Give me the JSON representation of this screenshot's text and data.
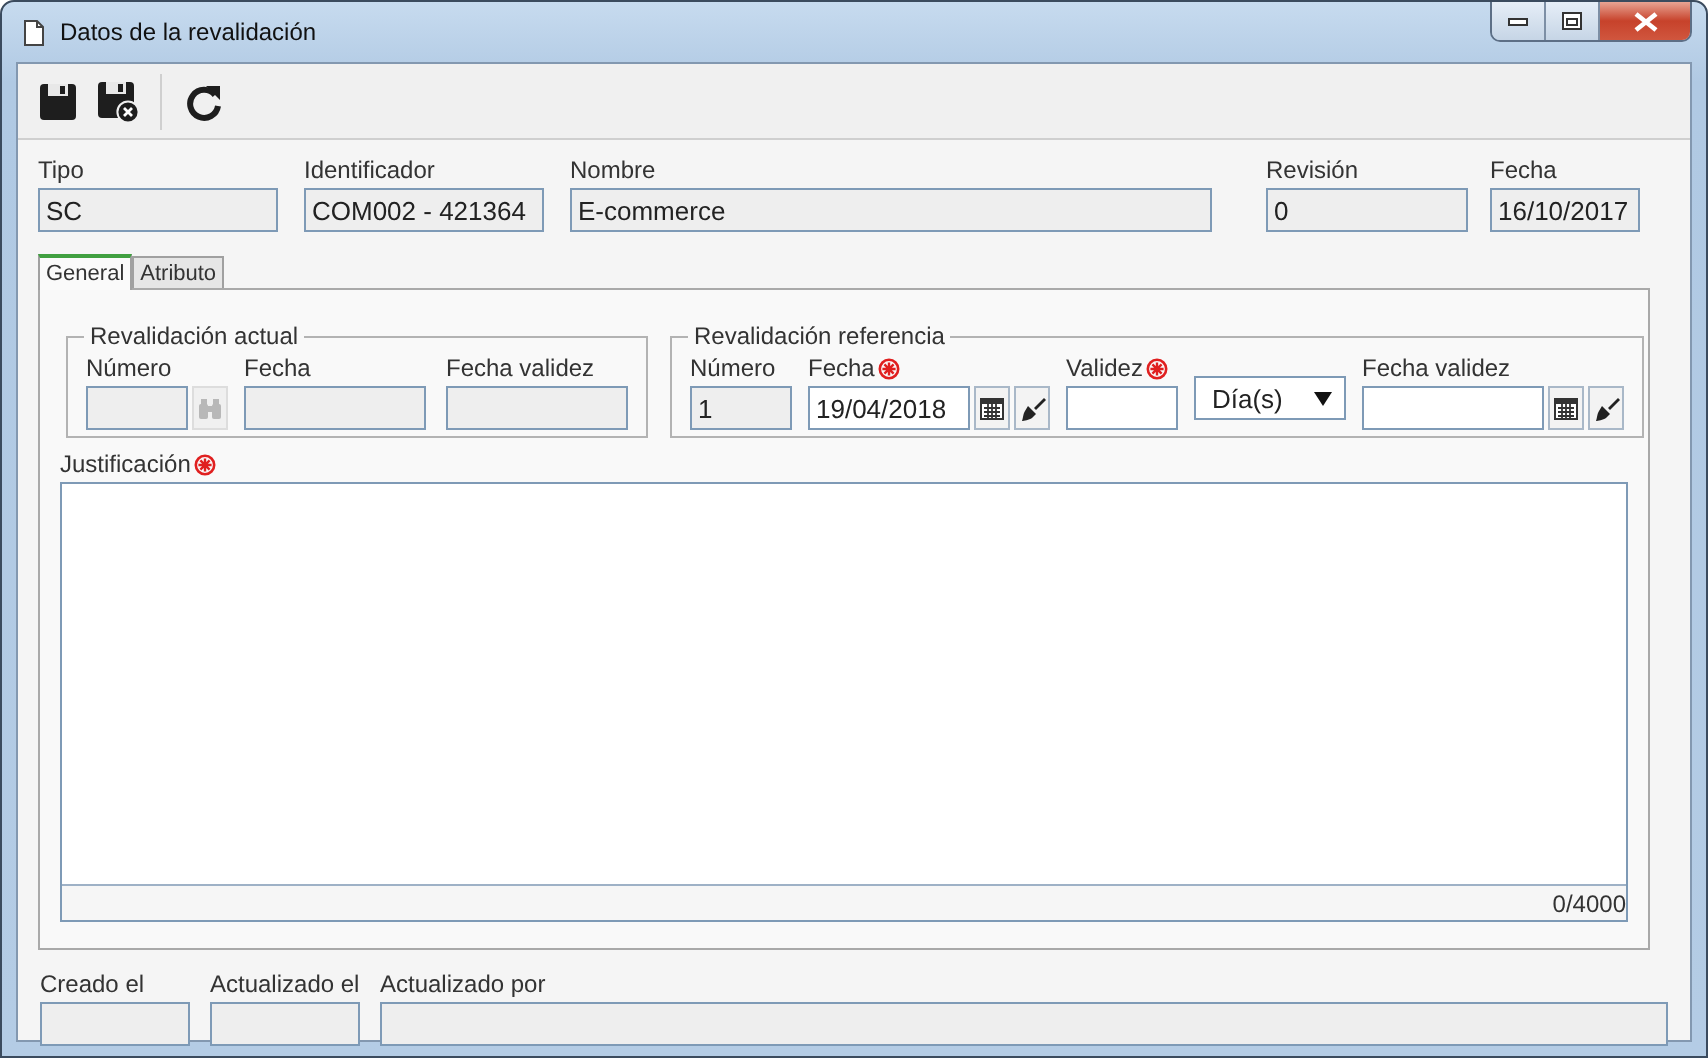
{
  "window": {
    "title": "Datos de la revalidación"
  },
  "header_fields": [
    {
      "label": "Tipo",
      "value": "SC",
      "disabled": true
    },
    {
      "label": "Identificador",
      "value": "COM002 - 421364",
      "disabled": true
    },
    {
      "label": "Nombre",
      "value": "E-commerce",
      "disabled": true
    },
    {
      "label": "Revisión",
      "value": "0",
      "disabled": true
    },
    {
      "label": "Fecha",
      "value": "16/10/2017",
      "disabled": true
    }
  ],
  "tabs": [
    {
      "label": "General",
      "selected": true
    },
    {
      "label": "Atributo",
      "selected": false
    }
  ],
  "groups": [
    {
      "title": "Revalidación actual",
      "fields": [
        {
          "kind": "lookup",
          "label": "Número",
          "disabled": true,
          "required": false
        },
        {
          "kind": "text",
          "label": "Fecha",
          "disabled": true,
          "required": false
        },
        {
          "kind": "text",
          "label": "Fecha validez",
          "disabled": true,
          "required": false
        }
      ]
    },
    {
      "title": "Revalidación referencia",
      "fields": [
        {
          "kind": "text",
          "label": "Número",
          "value": "1",
          "disabled": true,
          "required": false
        },
        {
          "kind": "date",
          "label": "Fecha",
          "value": "19/04/2018",
          "disabled": false,
          "required": true
        },
        {
          "kind": "text",
          "label": "Validez",
          "disabled": false,
          "required": true
        },
        {
          "kind": "select",
          "value": "Día(s)",
          "disabled": false
        },
        {
          "kind": "date",
          "label": "Fecha validez",
          "disabled": false,
          "required": false
        }
      ]
    }
  ],
  "justification": {
    "label": "Justificación",
    "required": true,
    "counter": "0/4000"
  },
  "footer_fields": [
    {
      "label": "Creado el",
      "disabled": true
    },
    {
      "label": "Actualizado el",
      "disabled": true
    },
    {
      "label": "Actualizado por",
      "disabled": true
    }
  ]
}
